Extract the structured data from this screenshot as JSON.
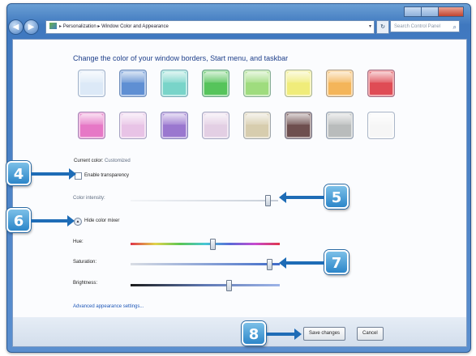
{
  "window": {
    "breadcrumb": [
      "Personalization",
      "Window Color and Appearance"
    ],
    "breadcrumb_sep": "▸",
    "search_placeholder": "Search Control Panel"
  },
  "heading": "Change the color of your window borders, Start menu, and taskbar",
  "swatches": [
    "#dce9f7",
    "#5f8fd3",
    "#79d4c9",
    "#56c45b",
    "#9fdc7e",
    "#f0ec7a",
    "#f4b55a",
    "#df4c55",
    "#e678c6",
    "#e8c3e6",
    "#9a77cf",
    "#e3cfe4",
    "#d7cdae",
    "#6e4f4f",
    "#b9bcbc",
    "#f6f6f6"
  ],
  "current_color": {
    "label": "Current color:",
    "value": "Customized"
  },
  "transparency": {
    "label": "Enable transparency",
    "checked": false
  },
  "intensity": {
    "label": "Color intensity:",
    "value": 0.93
  },
  "mixer": {
    "toggle_label": "Hide color mixer",
    "hue_label": "Hue:",
    "hue_value": 0.55,
    "saturation_label": "Saturation:",
    "saturation_value": 0.93,
    "brightness_label": "Brightness:",
    "brightness_value": 0.66
  },
  "advanced_link": "Advanced appearance settings...",
  "buttons": {
    "save": "Save changes",
    "cancel": "Cancel"
  },
  "callouts": {
    "c4": "4",
    "c5": "5",
    "c6": "6",
    "c7": "7",
    "c8": "8"
  },
  "colors": {
    "callout": "#2c86c9",
    "heading": "#1e3f8a",
    "link": "#1f58b8"
  }
}
